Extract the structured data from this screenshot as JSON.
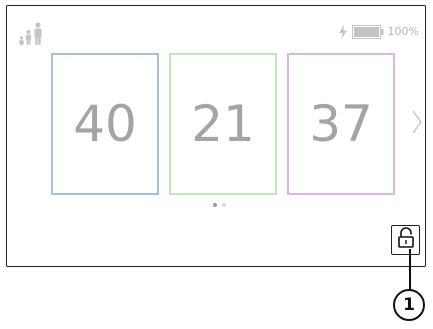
{
  "status": {
    "battery_percent_label": "100%",
    "battery_level": 1.0,
    "charging": true
  },
  "cards": [
    {
      "value": "40",
      "border_color": "#a7bde1"
    },
    {
      "value": "21",
      "border_color": "#c6e3bf"
    },
    {
      "value": "37",
      "border_color": "#d7b9e0"
    }
  ],
  "pagination": {
    "page_count": 2,
    "current_page": 1
  },
  "icons": {
    "profile": "family-icon",
    "charging": "lightning-bolt-icon",
    "battery": "battery-icon",
    "next": "chevron-right-icon",
    "lock": "unlocked-padlock-icon"
  },
  "callout": {
    "label": "1"
  },
  "colors": {
    "text_gray": "#a4a4a4",
    "icon_gray": "#c4c4c4",
    "frame": "#222222"
  }
}
